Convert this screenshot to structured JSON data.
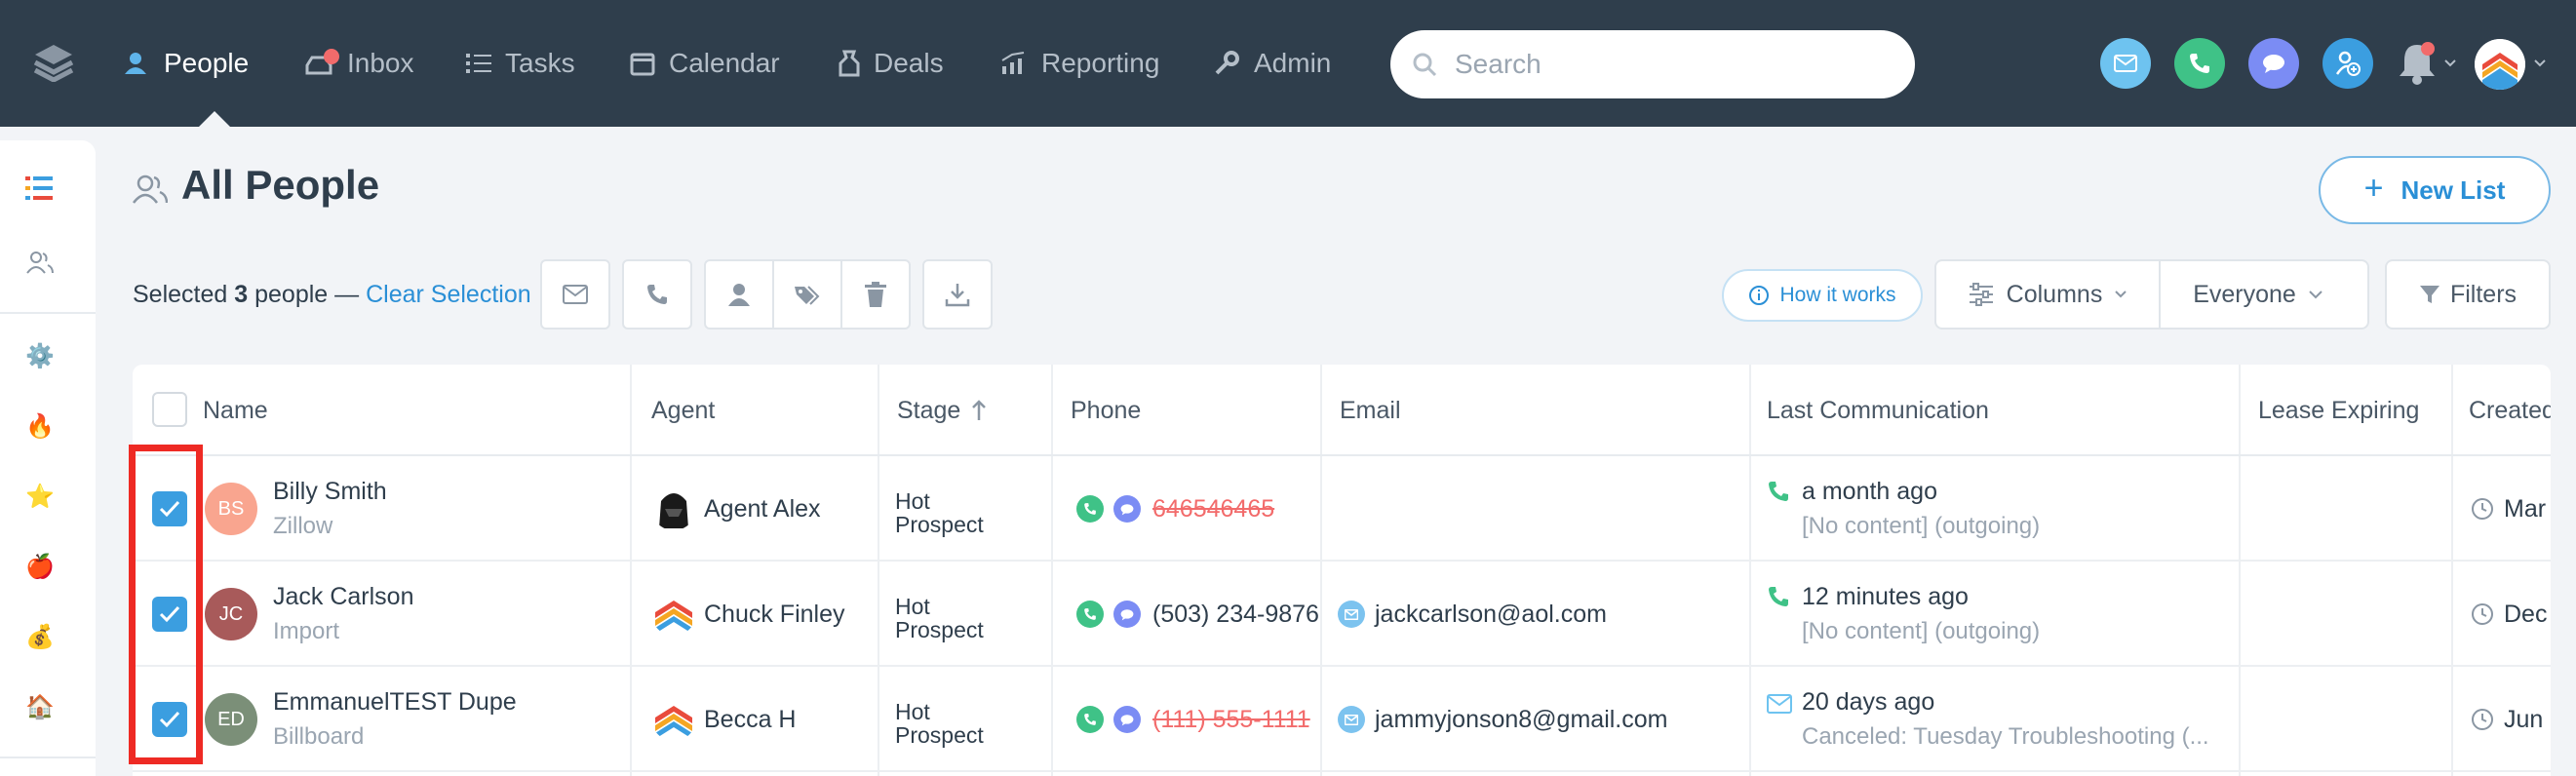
{
  "nav": {
    "items": [
      {
        "label": "People",
        "icon": "people-icon",
        "active": true
      },
      {
        "label": "Inbox",
        "icon": "inbox-icon",
        "badge": true
      },
      {
        "label": "Tasks",
        "icon": "tasks-icon"
      },
      {
        "label": "Calendar",
        "icon": "calendar-icon"
      },
      {
        "label": "Deals",
        "icon": "deals-icon"
      },
      {
        "label": "Reporting",
        "icon": "reporting-icon"
      },
      {
        "label": "Admin",
        "icon": "admin-icon"
      }
    ],
    "search_placeholder": "Search",
    "quick_actions": [
      "email-icon",
      "phone-icon",
      "chat-icon",
      "add-person-icon"
    ],
    "colors": {
      "bar": "#2f3e4c",
      "email": "#6ec3f0",
      "phone": "#3fc287",
      "chat": "#7b8cf4",
      "add_person": "#3b9ee0"
    }
  },
  "sidebar": {
    "icons": [
      "list-icon",
      "people-icon",
      "gear-icon",
      "fire-icon",
      "star-icon",
      "apple-icon",
      "money-bag-icon",
      "house-icon"
    ]
  },
  "header": {
    "title": "All People",
    "new_list_label": "New List"
  },
  "toolbar": {
    "selected_prefix": "Selected",
    "selected_count": "3",
    "selected_suffix": "people —",
    "clear_selection": "Clear Selection",
    "how_it_works": "How it works",
    "columns_label": "Columns",
    "everyone_label": "Everyone",
    "filters_label": "Filters"
  },
  "table": {
    "columns": [
      "Name",
      "Agent",
      "Stage",
      "Phone",
      "Email",
      "Last Communication",
      "Lease Expiring",
      "Created"
    ],
    "rows": [
      {
        "initials": "BS",
        "avatar_color": "#f9a58f",
        "name": "Billy Smith",
        "source": "Zillow",
        "agent": "Agent Alex",
        "stage_line1": "Hot",
        "stage_line2": "Prospect",
        "phone": "646546465",
        "phone_invalid": true,
        "email": "",
        "last_comm_type": "phone",
        "last_comm_time": "a month ago",
        "last_comm_note": "[No content] (outgoing)",
        "created": "Mar"
      },
      {
        "initials": "JC",
        "avatar_color": "#a85a5a",
        "name": "Jack Carlson",
        "source": "Import",
        "agent": "Chuck Finley",
        "stage_line1": "Hot",
        "stage_line2": "Prospect",
        "phone": "(503) 234-9876",
        "phone_invalid": false,
        "email": "jackcarlson@aol.com",
        "last_comm_type": "phone",
        "last_comm_time": "12 minutes ago",
        "last_comm_note": "[No content] (outgoing)",
        "created": "Dec"
      },
      {
        "initials": "ED",
        "avatar_color": "#7b8f78",
        "name": "EmmanuelTEST Dupe",
        "source": "Billboard",
        "agent": "Becca H",
        "stage_line1": "Hot",
        "stage_line2": "Prospect",
        "phone": "(111) 555-1111",
        "phone_invalid": true,
        "email": "jammyjonson8@gmail.com",
        "last_comm_type": "email",
        "last_comm_time": "20 days ago",
        "last_comm_note": "Canceled: Tuesday Troubleshooting (...",
        "created": "Jun"
      }
    ]
  }
}
